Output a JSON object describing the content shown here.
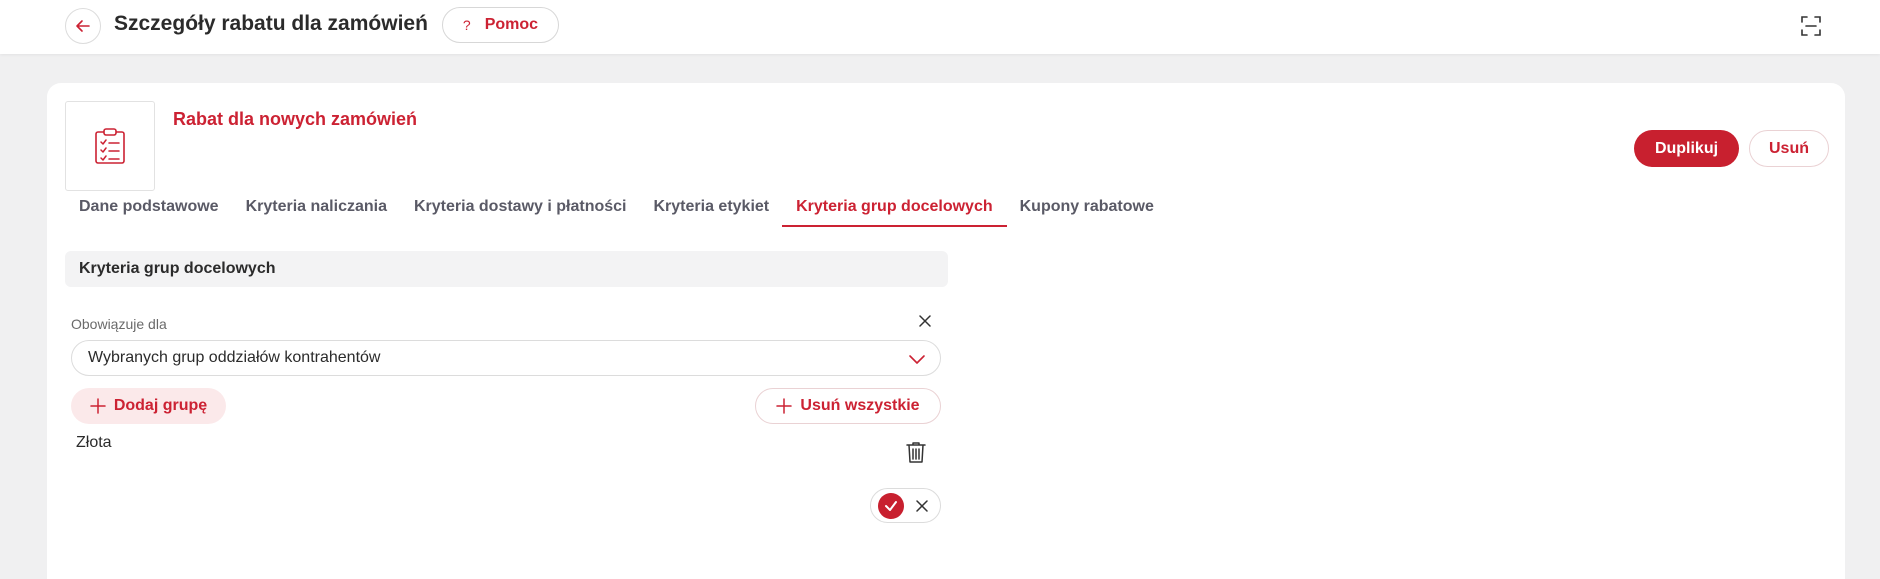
{
  "header": {
    "title": "Szczegóły rabatu dla zamówień",
    "help_label": "Pomoc",
    "help_icon": "?"
  },
  "discount": {
    "name": "Rabat dla nowych zamówień",
    "duplicate_label": "Duplikuj",
    "delete_label": "Usuń"
  },
  "tabs": [
    {
      "label": "Dane podstawowe",
      "active": false
    },
    {
      "label": "Kryteria naliczania",
      "active": false
    },
    {
      "label": "Kryteria dostawy i płatności",
      "active": false
    },
    {
      "label": "Kryteria etykiet",
      "active": false
    },
    {
      "label": "Kryteria grup docelowych",
      "active": true
    },
    {
      "label": "Kupony rabatowe",
      "active": false
    }
  ],
  "section": {
    "title": "Kryteria grup docelowych",
    "applies_label": "Obowiązuje dla",
    "applies_value": "Wybranych grup oddziałów kontrahentów",
    "add_group_label": "Dodaj grupę",
    "remove_all_label": "Usuń wszystkie",
    "groups": [
      "Złota"
    ]
  },
  "colors": {
    "accent": "#cc2233",
    "accent_dark": "#c8202f",
    "background": "#f0f0f1"
  }
}
